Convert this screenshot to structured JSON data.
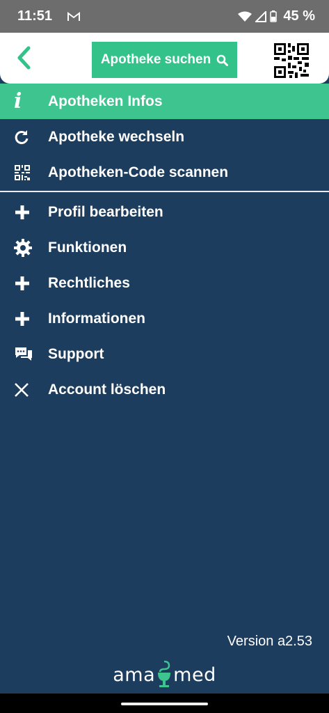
{
  "status": {
    "time": "11:51",
    "battery": "45 %"
  },
  "header": {
    "search_label": "Apotheke suchen"
  },
  "menu": {
    "items": [
      {
        "label": "Apotheken Infos",
        "icon": "info-icon"
      },
      {
        "label": "Apotheke wechseln",
        "icon": "refresh-icon"
      },
      {
        "label": "Apotheken-Code scannen",
        "icon": "qr-code-icon"
      },
      {
        "label": "Profil bearbeiten",
        "icon": "plus-icon"
      },
      {
        "label": "Funktionen",
        "icon": "gear-icon"
      },
      {
        "label": "Rechtliches",
        "icon": "plus-icon"
      },
      {
        "label": "Informationen",
        "icon": "plus-icon"
      },
      {
        "label": "Support",
        "icon": "chat-icon"
      },
      {
        "label": "Account löschen",
        "icon": "close-icon"
      }
    ]
  },
  "footer": {
    "version": "Version a2.53",
    "brand_left": "ama",
    "brand_right": "med"
  },
  "colors": {
    "background": "#1d3d5e",
    "accent": "#3dc48f",
    "status_bar": "#6d6d6d"
  }
}
